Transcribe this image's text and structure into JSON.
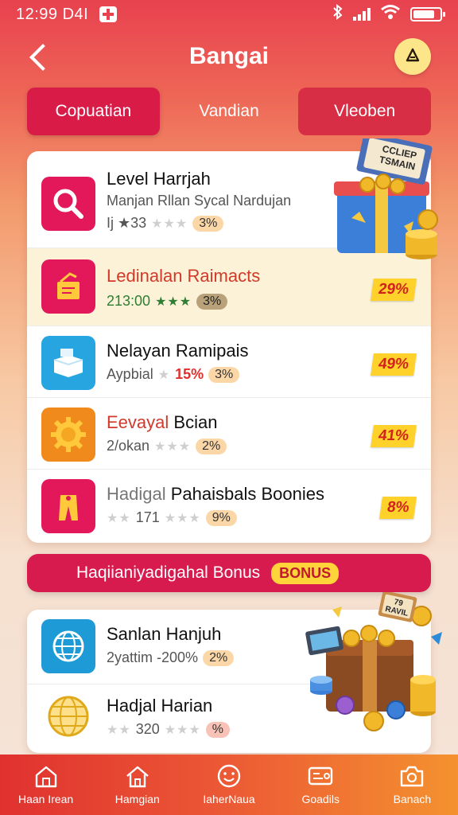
{
  "status": {
    "time": "12:99 D4I"
  },
  "header": {
    "title": "Bangai"
  },
  "tabs": [
    {
      "label": "Copuatian"
    },
    {
      "label": "Vandian"
    },
    {
      "label": "Vleoben"
    }
  ],
  "list": [
    {
      "title": "Level Harrjah",
      "subtitle": "Manjan Rllan Sycal Nardujan",
      "meta_left": "Ij ★33",
      "pill": "3%"
    },
    {
      "title": "Ledinalan Raimacts",
      "meta_left": "213:00",
      "pill": "3%",
      "badge": "29%"
    },
    {
      "title": "Nelayan Ramipais",
      "meta_left": "Aypbial",
      "pct": "15%",
      "pill": "3%",
      "badge": "49%"
    },
    {
      "title": "Eevayal Bcian",
      "title_red": "Eevayal",
      "title_rest": "Bcian",
      "meta_left": "2/okan",
      "pill": "2%",
      "badge": "41%"
    },
    {
      "title_gray": "Hadigal",
      "title_rest": "Pahaisbals Boonies",
      "meta_left": "171",
      "pill": "9%",
      "badge": "8%"
    }
  ],
  "bonus": {
    "label": "Haqiianiyadigahal Bonus",
    "tag": "BONUS"
  },
  "list2": [
    {
      "title": "Sanlan Hanjuh",
      "meta_left": "2yattim -200%",
      "pill": "2%"
    },
    {
      "title": "Hadjal Harian",
      "meta_left": "320",
      "pill": "%"
    }
  ],
  "art": {
    "gift_sign": "CCLIEP TSMAIN",
    "chest_sign": "79 RAVIL"
  },
  "nav": [
    {
      "label": "Haan Irean",
      "icon": "house-icon"
    },
    {
      "label": "Hamgian",
      "icon": "home-icon"
    },
    {
      "label": "IaherNaua",
      "icon": "smile-icon"
    },
    {
      "label": "Goadils",
      "icon": "card-icon"
    },
    {
      "label": "Banach",
      "icon": "camera-icon"
    }
  ],
  "colors": {
    "primary": "#d81b47",
    "accent": "#ffd12b",
    "highlight_row": "#fbf2d8"
  }
}
